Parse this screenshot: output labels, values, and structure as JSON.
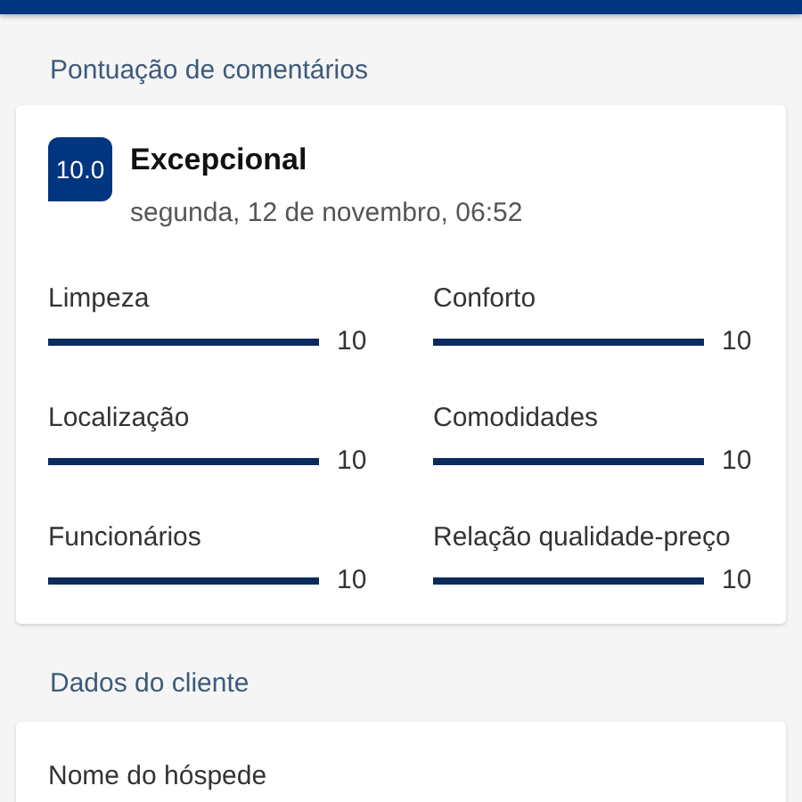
{
  "score_section": {
    "heading": "Pontuação de comentários",
    "badge": "10.0",
    "rating": "Excepcional",
    "date": "segunda, 12 de novembro, 06:52",
    "categories": [
      {
        "name": "Limpeza",
        "level": 1,
        "reading": "10"
      },
      {
        "name": "Conforto",
        "level": 1,
        "reading": "10"
      },
      {
        "name": "Localização",
        "level": 1,
        "reading": "10"
      },
      {
        "name": "Comodidades",
        "level": 1,
        "reading": "10"
      },
      {
        "name": "Funcionários",
        "level": 1,
        "reading": "10"
      },
      {
        "name": "Relação qualidade-preço",
        "level": 1,
        "reading": "10"
      }
    ]
  },
  "customer_section": {
    "heading": "Dados do cliente",
    "field_label": "Nome do hóspede"
  }
}
